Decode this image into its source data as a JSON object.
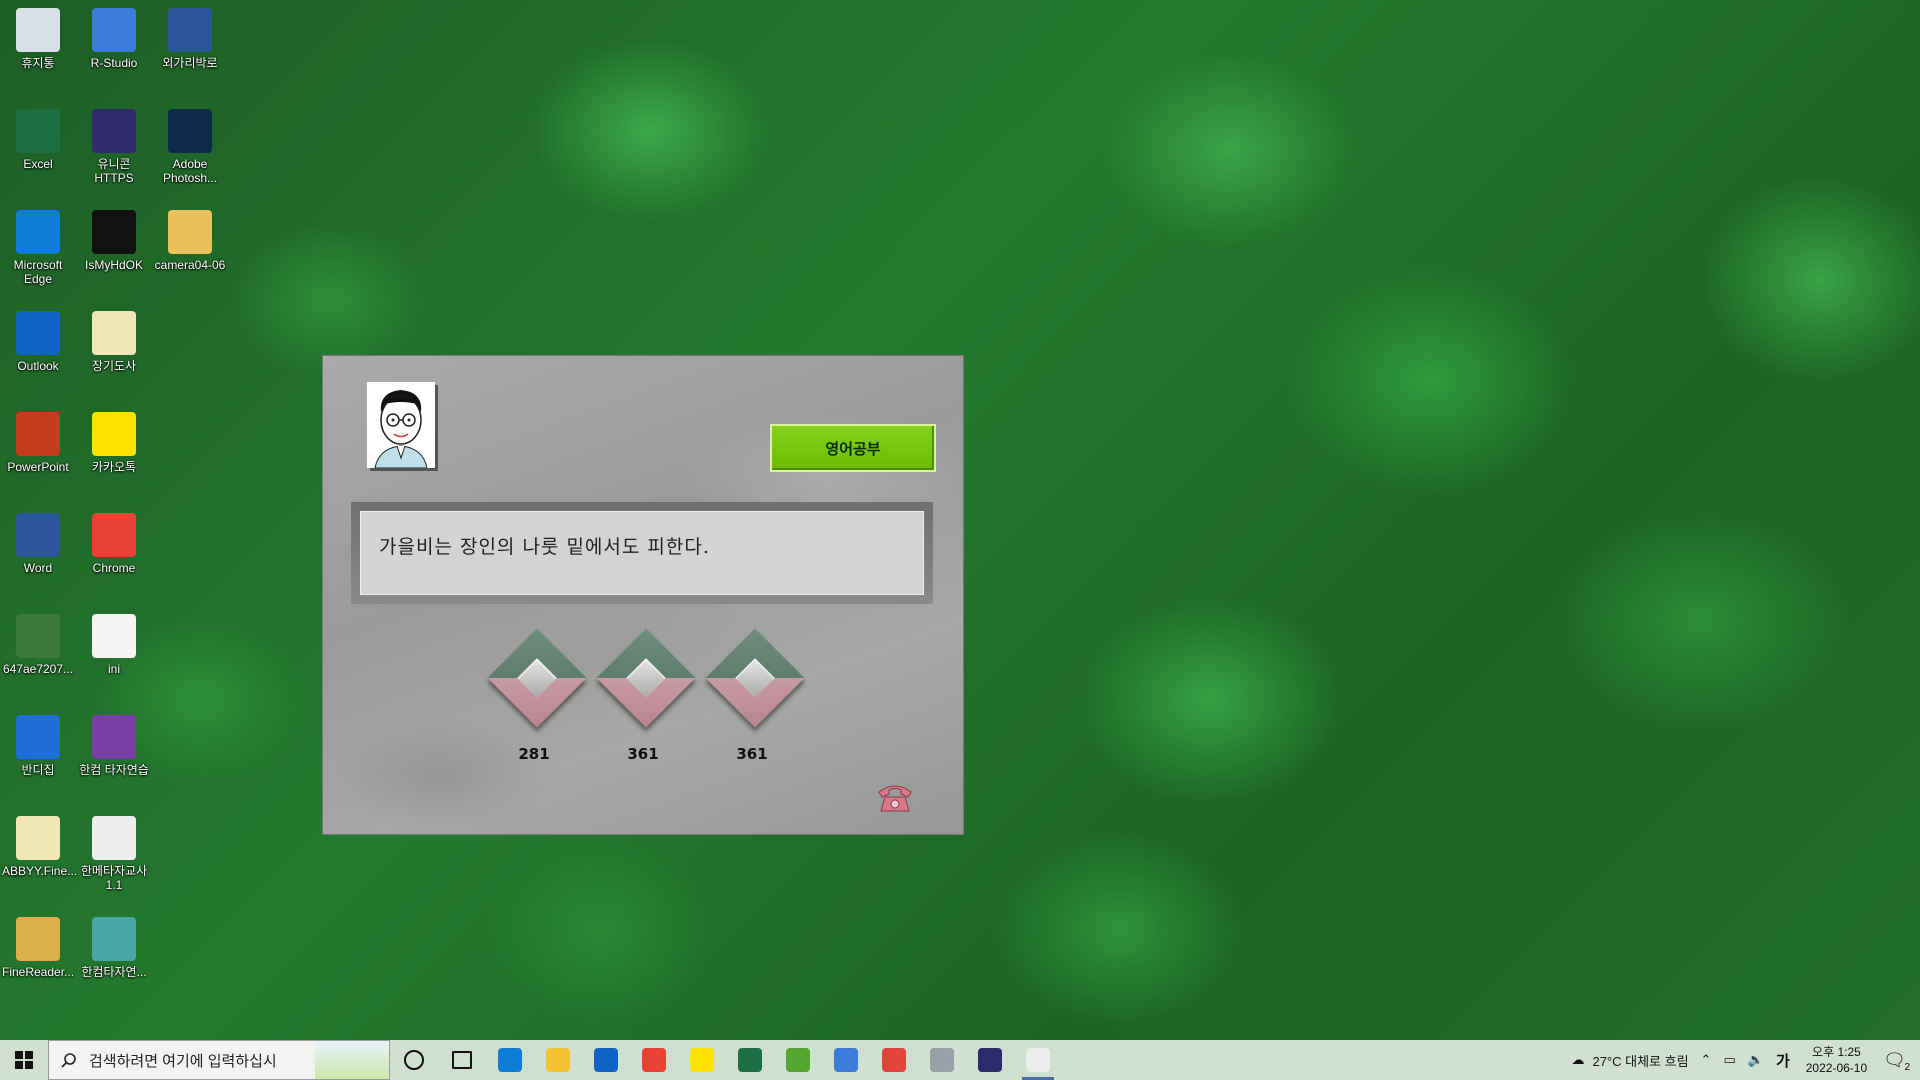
{
  "desktop_icons": [
    {
      "label": "휴지통",
      "icon": "recycle-bin-icon",
      "color": "#d8e0e8"
    },
    {
      "label": "R-Studio",
      "icon": "r-studio-icon",
      "color": "#3b7dd8"
    },
    {
      "label": "외가리박로",
      "icon": "word-doc-icon",
      "color": "#2b579a"
    },
    {
      "label": "Excel",
      "icon": "excel-icon",
      "color": "#1d6f42"
    },
    {
      "label": "유니콘 HTTPS",
      "icon": "unicorn-https-icon",
      "color": "#2f2a6b"
    },
    {
      "label": "Adobe Photosh...",
      "icon": "photoshop-icon",
      "color": "#0f2a4a"
    },
    {
      "label": "Microsoft Edge",
      "icon": "edge-icon",
      "color": "#0f7cd6"
    },
    {
      "label": "IsMyHdOK",
      "icon": "ismyhdok-icon",
      "color": "#111111"
    },
    {
      "label": "camera04-06",
      "icon": "folder-icon",
      "color": "#e8c15a"
    },
    {
      "label": "Outlook",
      "icon": "outlook-icon",
      "color": "#0f64c5"
    },
    {
      "label": "장기도사",
      "icon": "document-icon",
      "color": "#f1e6b5"
    },
    {
      "label": "PowerPoint",
      "icon": "powerpoint-icon",
      "color": "#c43e1c"
    },
    {
      "label": "카카오톡",
      "icon": "kakaotalk-icon",
      "color": "#fae100"
    },
    {
      "label": "Word",
      "icon": "word-icon",
      "color": "#2b579a"
    },
    {
      "label": "Chrome",
      "icon": "chrome-icon",
      "color": "#e94235"
    },
    {
      "label": "647ae7207...",
      "icon": "image-file-icon",
      "color": "#3a7a3a"
    },
    {
      "label": "ini",
      "icon": "text-file-icon",
      "color": "#f4f4f4"
    },
    {
      "label": "반디집",
      "icon": "bandizip-icon",
      "color": "#1f6fd6"
    },
    {
      "label": "한컴 타자연습",
      "icon": "hancom-typing-icon",
      "color": "#7a3fa8"
    },
    {
      "label": "ABBYY.Fine...",
      "icon": "document-icon",
      "color": "#f1e6b5"
    },
    {
      "label": "한메타자교사 1.1",
      "icon": "hanme-typing-icon",
      "color": "#eeeeee"
    },
    {
      "label": "FineReader...",
      "icon": "finereader-icon",
      "color": "#d9b04a"
    },
    {
      "label": "한컴타자연...",
      "icon": "archive-icon",
      "color": "#4aa6a6"
    }
  ],
  "dialog": {
    "study_button_label": "영어공부",
    "proverb": "가을비는 장인의 나룻 밑에서도 피한다.",
    "scores": [
      "281",
      "361",
      "361"
    ]
  },
  "taskbar": {
    "search_placeholder": "검색하려면 여기에 입력하십시",
    "apps": [
      {
        "name": "cortana",
        "icon": "cortana-icon",
        "color": "#ffffff"
      },
      {
        "name": "task-view",
        "icon": "task-view-icon",
        "color": "#ffffff"
      },
      {
        "name": "edge",
        "icon": "edge-icon",
        "color": "#0f7cd6"
      },
      {
        "name": "file-explorer",
        "icon": "folder-icon",
        "color": "#f2c230"
      },
      {
        "name": "mail",
        "icon": "mail-icon",
        "color": "#0f64c5"
      },
      {
        "name": "chrome",
        "icon": "chrome-icon",
        "color": "#e94235"
      },
      {
        "name": "kakaotalk",
        "icon": "kakaotalk-icon",
        "color": "#fae100"
      },
      {
        "name": "excel",
        "icon": "excel-icon",
        "color": "#1d6f42"
      },
      {
        "name": "utorrent",
        "icon": "utorrent-icon",
        "color": "#55a630"
      },
      {
        "name": "network",
        "icon": "globe-icon",
        "color": "#3b7dd8"
      },
      {
        "name": "app-red",
        "icon": "app-icon",
        "color": "#e0453a"
      },
      {
        "name": "app-gray",
        "icon": "app-icon",
        "color": "#9aa0a6"
      },
      {
        "name": "unicorn",
        "icon": "unicorn-https-icon",
        "color": "#2f2a6b"
      },
      {
        "name": "typing-tutor",
        "icon": "hanme-typing-icon",
        "color": "#eeeeee"
      }
    ],
    "weather": "27°C 대체로 흐림",
    "ime": "가",
    "time": "오후 1:25",
    "date": "2022-06-10",
    "notification_count": "2"
  }
}
